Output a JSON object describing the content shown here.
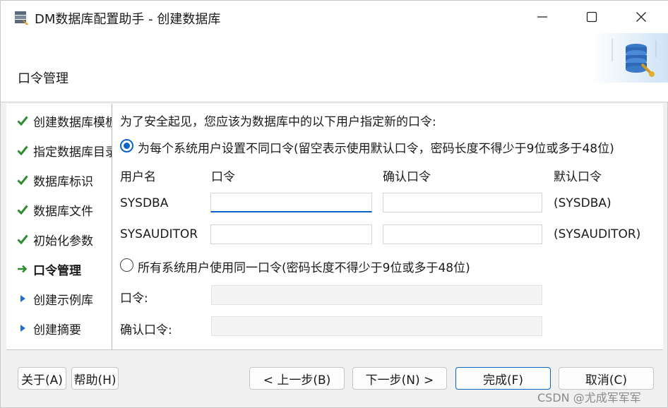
{
  "window": {
    "title": "DM数据库配置助手 - 创建数据库"
  },
  "header": {
    "title": "口令管理"
  },
  "sidebar": {
    "items": [
      {
        "label": "创建数据库模板",
        "state": "done"
      },
      {
        "label": "指定数据库目录",
        "state": "done"
      },
      {
        "label": "数据库标识",
        "state": "done"
      },
      {
        "label": "数据库文件",
        "state": "done"
      },
      {
        "label": "初始化参数",
        "state": "done"
      },
      {
        "label": "口令管理",
        "state": "current"
      },
      {
        "label": "创建示例库",
        "state": "pending"
      },
      {
        "label": "创建摘要",
        "state": "pending"
      }
    ]
  },
  "main": {
    "intro": "为了安全起见，您应该为数据库中的以下用户指定新的口令:",
    "option_separate": {
      "label": "为每个系统用户设置不同口令(留空表示使用默认口令，密码长度不得少于9位或多于48位)",
      "checked": true
    },
    "columns": {
      "user": "用户名",
      "password": "口令",
      "confirm": "确认口令",
      "default": "默认口令"
    },
    "rows": [
      {
        "user": "SYSDBA",
        "password": "",
        "confirm": "",
        "default": "(SYSDBA)"
      },
      {
        "user": "SYSAUDITOR",
        "password": "",
        "confirm": "",
        "default": "(SYSAUDITOR)"
      }
    ],
    "option_same": {
      "label": "所有系统用户使用同一口令(密码长度不得少于9位或多于48位)",
      "checked": false
    },
    "same_password_label": "口令:",
    "same_confirm_label": "确认口令:",
    "same_password_value": "",
    "same_confirm_value": ""
  },
  "footer": {
    "about": "关于(A)",
    "help": "帮助(H)",
    "prev": "< 上一步(B)",
    "next": "下一步(N) >",
    "finish": "完成(F)",
    "cancel": "取消(C)"
  },
  "watermark": "CSDN @尤成军军军",
  "colors": {
    "accent": "#0a64c8",
    "check_green": "#2e8b2e",
    "arrow_blue": "#1e6fd0"
  }
}
